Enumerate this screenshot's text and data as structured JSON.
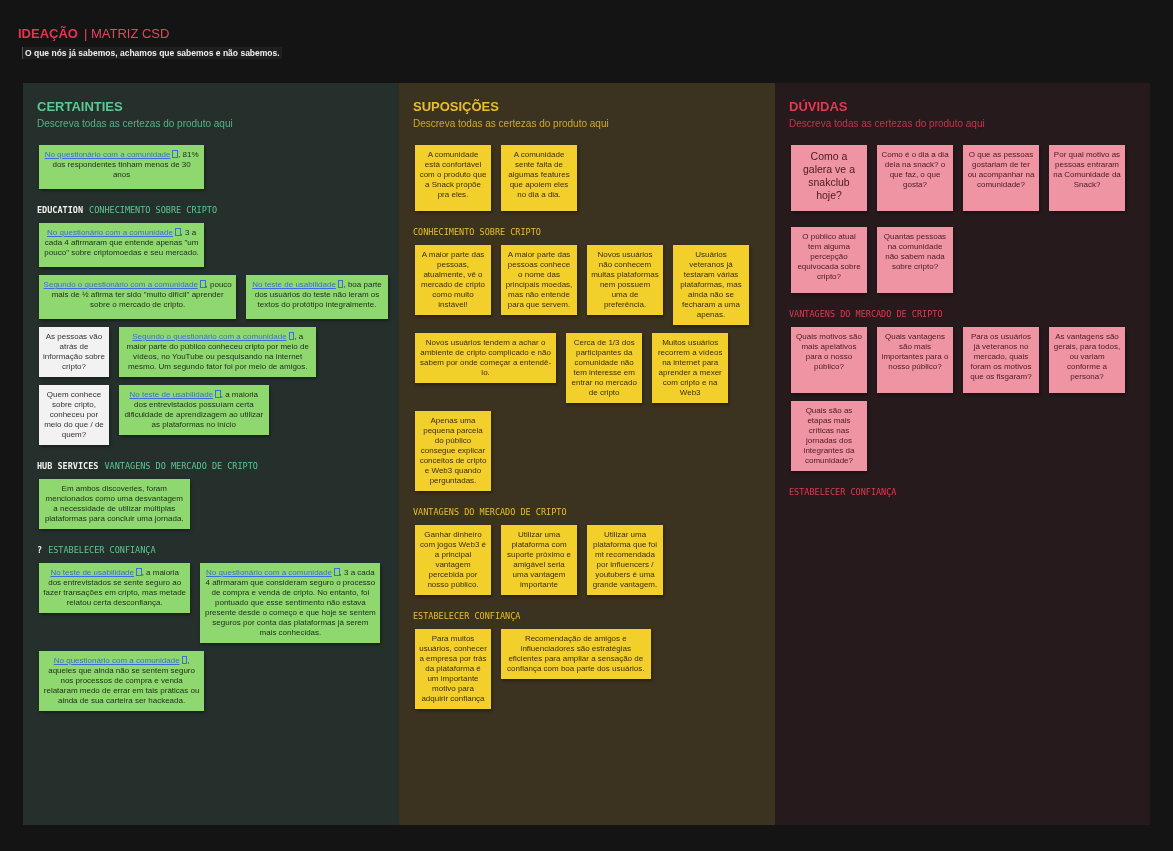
{
  "header": {
    "title": "IDEAÇÃO",
    "subtitle": "| MATRIZ CSD",
    "description": "O que nós  já sabemos, achamos que sabemos e não sabemos."
  },
  "columns": [
    {
      "kind": "certainties",
      "title": "CERTAINTIES",
      "subtitle": "Descreva todas as certezas do produto aqui",
      "sections": [
        {
          "notes": [
            {
              "kind": "card",
              "link": "No questionário com a comunidade",
              "text": ", 81% dos respondentes tinham menos de 30 anos"
            }
          ]
        },
        {
          "prefix": "EDUCATION",
          "title": "CONHECIMENTO SOBRE CRIPTO",
          "notes": [
            {
              "kind": "card",
              "link": "No questionário com a comunidade",
              "text": ", 3 a cada 4 afirmaram que entende apenas \"um pouco\" sobre criptomoedas e seu mercado."
            },
            {
              "kind": "card",
              "link": "Segundo o questionário com a comunidade",
              "text": ", pouco mais de ½ afirma ter sido \"muito difícil\" aprender sobre o mercado de cripto."
            },
            {
              "kind": "card",
              "link": "No teste de usabilidade",
              "text": ", boa parte dos usuários do teste não leram os textos do protótipo integralmente."
            },
            {
              "kind": "mini",
              "text": "As pessoas vão atrás de informação sobre cripto?"
            },
            {
              "kind": "card",
              "link": "Segundo o questionário com a comunidade",
              "text": ", a maior parte do público conheceu cripto por meio de vídeos, no YouTube ou pesquisando na internet mesmo. Um segundo fator foi por meio de amigos."
            },
            {
              "kind": "mini",
              "text": "Quem conhece sobre cripto, conheceu por meio do que / de quem?"
            },
            {
              "kind": "card",
              "link": "No teste de usabilidade",
              "text": ", a maioria dos entrevistados possuíam certa dificuldade de aprendizagem ao utilizar as plataformas no início"
            }
          ]
        },
        {
          "prefix": "HUB SERVICES",
          "title": "VANTAGENS DO MERCADO DE CRIPTO",
          "notes": [
            {
              "kind": "card",
              "text": "Em ambos discoveries, foram mencionados como uma desvantagem a necessidade de utilizar múltiplas plataformas para concluir uma jornada."
            }
          ]
        },
        {
          "prefix": "?",
          "title": "ESTABELECER CONFIANÇA",
          "notes": [
            {
              "kind": "card",
              "link": "No teste de usabilidade",
              "text": ", a maioria dos entrevistados se sente seguro ao fazer transações em cripto, mas metade relatou certa desconfiança."
            },
            {
              "kind": "card",
              "link": "No questionário com a comunidade",
              "text": ", 3 a cada 4 afirmaram que consideram seguro o processo de compra e venda de cripto. No entanto, foi pontuado que esse sentimento não estava presente desde o começo e que hoje se sentem seguros por conta das plataformas já serem mais conhecidas."
            },
            {
              "kind": "card",
              "link": "No questionário com a comunidade",
              "text": ", aqueles que ainda não se sentem seguro nos processos de compra e venda relataram medo de errar em tais práticas ou ainda de sua carteira ser hackeada."
            }
          ]
        }
      ]
    },
    {
      "kind": "suppositions",
      "title": "SUPOSIÇÕES",
      "subtitle": "Descreva todas as certezas do produto aqui",
      "sections": [
        {
          "notes": [
            {
              "kind": "square",
              "text": "A comunidade está confortável com o produto que a Snack propõe pra eles."
            },
            {
              "kind": "square",
              "text": "A comunidade sente falta de algumas features que apoiem eles no dia a dia."
            }
          ]
        },
        {
          "title": "CONHECIMENTO SOBRE CRIPTO",
          "notes": [
            {
              "kind": "square",
              "text": "A maior parte das pessoas, atualmente, vê o mercado de cripto como muito instável!"
            },
            {
              "kind": "square",
              "text": "A maior parte das pessoas conhece o nome das principais moedas, mas não entende para que servem."
            },
            {
              "kind": "square",
              "text": "Novos usuários não conhecem muitas plataformas nem possuem uma de preferência."
            },
            {
              "kind": "square",
              "text": "Usuários veteranos já testaram várias plataformas, mas ainda não se fecharam a uma apenas."
            },
            {
              "kind": "card",
              "text": "Novos usuários tendem a achar o ambiente de cripto complicado e não sabem por onde começar a entendê-lo."
            },
            {
              "kind": "square",
              "text": "Cerca de 1/3 dos participantes da comunidade não tem interesse em entrar no mercado de cripto"
            },
            {
              "kind": "square",
              "text": "Muitos usuários recorrem a vídeos na internet para aprender a mexer com cripto e na Web3"
            },
            {
              "kind": "square",
              "text": "Apenas uma pequena parcela do público consegue explicar conceitos de cripto e Web3 quando perguntadas."
            }
          ]
        },
        {
          "title": "VANTAGENS DO MERCADO DE CRIPTO",
          "notes": [
            {
              "kind": "square",
              "text": "Ganhar dinheiro com jogos Web3 é a principal vantagem percebida por nosso público."
            },
            {
              "kind": "square",
              "text": "Utilizar uma plataforma com suporte próximo e amigável seria uma vantagem importante"
            },
            {
              "kind": "square",
              "text": "Utilizar uma plataforma que foi mt recomendada por influencers / youtubers é uma grande vantagem."
            }
          ]
        },
        {
          "title": "ESTABELECER CONFIANÇA",
          "notes": [
            {
              "kind": "square",
              "text": "Para muitos usuários, conhecer a empresa por trás da plataforma é um importante motivo para adquirir confiança"
            },
            {
              "kind": "card",
              "text": "Recomendação de amigos e influenciadores são estratégias eficientes para ampliar a sensação de confiança com boa parte dos usuários."
            }
          ]
        }
      ]
    },
    {
      "kind": "doubts",
      "title": "DÚVIDAS",
      "subtitle": "Descreva todas as certezas do produto aqui",
      "sections": [
        {
          "notes": [
            {
              "kind": "square",
              "text": "Como a galera ve a snakclub hoje?"
            },
            {
              "kind": "square",
              "text": "Como é o dia a dia dela na snack? o que faz, o que gosta?"
            },
            {
              "kind": "square",
              "text": "O que as pessoas gostariam de ter ou acompanhar na comunidade?"
            },
            {
              "kind": "square",
              "text": "Por qual motivo as pessoas entraram na Comunidade da Snack?"
            }
          ]
        },
        {
          "notes": [
            {
              "kind": "square",
              "text": "O público atual tem alguma percepção equivocada sobre cripto?"
            },
            {
              "kind": "square",
              "text": "Quantas pessoas na comunidade não sabem nada sobre cripto?"
            }
          ]
        },
        {
          "title": "VANTAGENS DO MERCADO DE CRIPTO",
          "notes": [
            {
              "kind": "square",
              "text": "Quais motivos são mais apelativos para o nosso público?"
            },
            {
              "kind": "square",
              "text": "Quais vantagens são mais importantes para o nosso público?"
            },
            {
              "kind": "square",
              "text": "Para os usuários já veteranos no mercado, quais foram os motivos que os fisgaram?"
            },
            {
              "kind": "square",
              "text": "As vantagens são gerais, para todos, ou variam conforme a persona?"
            },
            {
              "kind": "square",
              "text": "Quais são as etapas mais críticas nas jornadas dos integrantes da comunidade?"
            }
          ]
        },
        {
          "title": "ESTABELECER CONFIANÇA"
        }
      ]
    }
  ]
}
